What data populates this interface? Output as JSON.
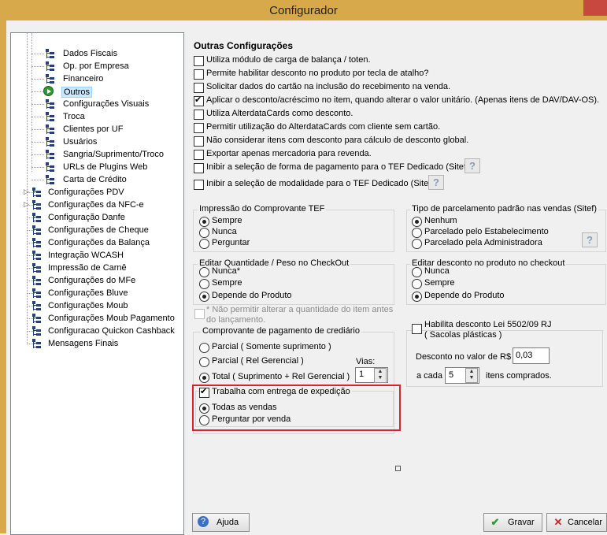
{
  "window": {
    "title": "Configurador"
  },
  "tree": {
    "children": [
      {
        "label": "Dados Fiscais"
      },
      {
        "label": "Op. por Empresa"
      },
      {
        "label": "Financeiro"
      },
      {
        "label": "Outros",
        "selected": true
      },
      {
        "label": "Configurações Visuais"
      },
      {
        "label": "Troca"
      },
      {
        "label": "Clientes por UF"
      },
      {
        "label": "Usuários"
      },
      {
        "label": "Sangria/Suprimento/Troco"
      },
      {
        "label": "URLs de Plugins Web"
      },
      {
        "label": "Carta de Crédito"
      }
    ],
    "roots": [
      {
        "label": "Configurações PDV",
        "expander": "right"
      },
      {
        "label": "Configurações da NFC-e",
        "expander": "right"
      },
      {
        "label": "Configuração Danfe"
      },
      {
        "label": "Configurações de Cheque"
      },
      {
        "label": "Configurações da Balança"
      },
      {
        "label": "Integração WCASH"
      },
      {
        "label": "Impressão de Carnê"
      },
      {
        "label": "Configurações do MFe"
      },
      {
        "label": "Configurações Bluve"
      },
      {
        "label": "Configurações Moub"
      },
      {
        "label": "Configurações Moub Pagamento"
      },
      {
        "label": "Configuracao Quickon Cashback"
      },
      {
        "label": "Mensagens Finais"
      }
    ]
  },
  "main": {
    "section_title": "Outras Configurações",
    "options": [
      {
        "label": "Utiliza módulo de carga de balança / toten.",
        "checked": false
      },
      {
        "label": "Permite habilitar desconto no produto por tecla de atalho?",
        "checked": false
      },
      {
        "label": "Solicitar dados do cartão na inclusão do recebimento na venda.",
        "checked": false
      },
      {
        "label": "Aplicar o desconto/acréscimo no item, quando alterar o valor unitário. (Apenas itens de DAV/DAV-OS).",
        "checked": true
      },
      {
        "label": "Utiliza AlterdataCards como desconto.",
        "checked": false
      },
      {
        "label": "Permitir utilização do AlterdataCards com cliente sem cartão.",
        "checked": false
      },
      {
        "label": "Não considerar itens com desconto para cálculo de desconto global.",
        "checked": false
      },
      {
        "label": "Exportar apenas mercadoria para revenda.",
        "checked": false
      },
      {
        "label": "Inibir a seleção de forma de pagamento para o TEF Dedicado (Sitef).",
        "checked": false,
        "help": "?"
      },
      {
        "label": "Inibir a seleção de modalidade para o TEF Dedicado (Sitef).",
        "checked": false,
        "help": "?"
      }
    ],
    "tef_print": {
      "title": "Impressão do Comprovante TEF",
      "options": [
        "Sempre",
        "Nunca",
        "Perguntar"
      ],
      "selected": "Sempre"
    },
    "installment": {
      "title": "Tipo de parcelamento padrão nas vendas (Sitef)",
      "options": [
        "Nenhum",
        "Parcelado pelo Estabelecimento",
        "Parcelado pela Administradora"
      ],
      "selected": "Nenhum",
      "help": "?"
    },
    "edit_qty": {
      "title": "Editar Quantidade / Peso no CheckOut",
      "options": [
        "Nunca*",
        "Sempre",
        "Depende do Produto"
      ],
      "selected": "Depende do Produto"
    },
    "edit_discount": {
      "title": "Editar desconto no produto no checkout",
      "options": [
        "Nunca",
        "Sempre",
        "Depende do Produto"
      ],
      "selected": "Depende do Produto"
    },
    "no_edit_qty": {
      "line1": "* Não permitir alterar a quantidade do item antes",
      "line2": "do lançamento.",
      "checked": false
    },
    "credit_receipt": {
      "title": "Comprovante de pagamento de crediário",
      "options": [
        "Parcial ( Somente suprimento )",
        "Parcial ( Rel Gerencial )",
        "Total ( Suprimento + Rel Gerencial )"
      ],
      "selected": "Total ( Suprimento + Rel Gerencial )",
      "copies_label": "Vias:",
      "copies_value": "1"
    },
    "delivery": {
      "label": "Trabalha com entrega de expedição",
      "checked": true,
      "options": [
        "Todas as vendas",
        "Perguntar por venda"
      ],
      "selected": "Todas as vendas"
    },
    "lei": {
      "title_line1": "Habilita desconto Lei 5502/09 RJ",
      "title_line2": "( Sacolas plásticas )",
      "checked": false,
      "discount_label": "Desconto no valor de R$",
      "discount_value": "0,03",
      "each_label": "a cada",
      "each_value": "5",
      "items_label": "itens comprados."
    }
  },
  "buttons": {
    "help": "Ajuda",
    "save": "Gravar",
    "cancel": "Cancelar"
  },
  "colors": {
    "titlebar": "#d7a94a",
    "close": "#c7483f",
    "highlight_box": "#d9232e",
    "tree_icon": "#22407e"
  }
}
